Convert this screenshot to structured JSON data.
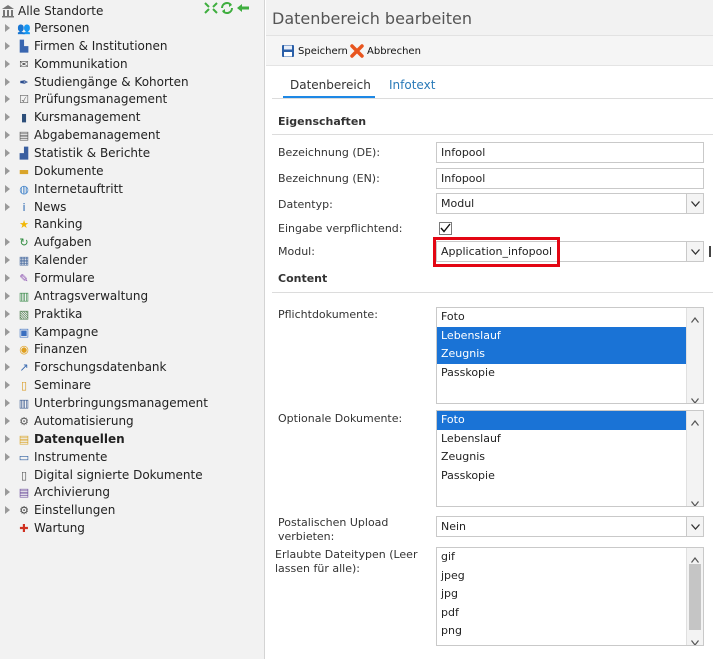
{
  "sidebar": {
    "root": {
      "label": "Alle Standorte",
      "icon": "building-icon"
    },
    "root_actions": [
      {
        "name": "expand-all-icon",
        "color": "#3fae3f"
      },
      {
        "name": "refresh-icon",
        "color": "#3fae3f"
      },
      {
        "name": "back-arrow-icon",
        "color": "#3fae3f"
      }
    ],
    "items": [
      {
        "label": "Personen",
        "icon": "persons-icon",
        "glyph": "👥",
        "color": "#7a55c8",
        "expandable": true
      },
      {
        "label": "Firmen & Institutionen",
        "icon": "factory-icon",
        "glyph": "▙",
        "color": "#3a66b0",
        "expandable": true
      },
      {
        "label": "Kommunikation",
        "icon": "envelope-icon",
        "glyph": "✉",
        "color": "#555555",
        "expandable": true
      },
      {
        "label": "Studiengänge & Kohorten",
        "icon": "feather-icon",
        "glyph": "✒",
        "color": "#2b4d8f",
        "expandable": true
      },
      {
        "label": "Prüfungsmanagement",
        "icon": "checklist-icon",
        "glyph": "☑",
        "color": "#666666",
        "expandable": true
      },
      {
        "label": "Kursmanagement",
        "icon": "book-icon",
        "glyph": "▮",
        "color": "#2d4f7a",
        "expandable": true
      },
      {
        "label": "Abgabemanagement",
        "icon": "submission-icon",
        "glyph": "▤",
        "color": "#555555",
        "expandable": true
      },
      {
        "label": "Statistik & Berichte",
        "icon": "bar-chart-icon",
        "glyph": "▟",
        "color": "#3a5fa0",
        "expandable": true
      },
      {
        "label": "Dokumente",
        "icon": "folder-icon",
        "glyph": "▬",
        "color": "#d9a52a",
        "expandable": true
      },
      {
        "label": "Internetauftritt",
        "icon": "globe-icon",
        "glyph": "◍",
        "color": "#3a7ec8",
        "expandable": true
      },
      {
        "label": "News",
        "icon": "info-icon",
        "glyph": "i",
        "color": "#1f5fae",
        "expandable": true
      },
      {
        "label": "Ranking",
        "icon": "star-icon",
        "glyph": "★",
        "color": "#f2b705",
        "expandable": false
      },
      {
        "label": "Aufgaben",
        "icon": "clock-arrow-icon",
        "glyph": "↻",
        "color": "#2e8b3e",
        "expandable": true
      },
      {
        "label": "Kalender",
        "icon": "calendar-icon",
        "glyph": "▦",
        "color": "#4a6ca0",
        "expandable": true
      },
      {
        "label": "Formulare",
        "icon": "form-icon",
        "glyph": "✎",
        "color": "#8a4fb0",
        "expandable": true
      },
      {
        "label": "Antragsverwaltung",
        "icon": "application-icon",
        "glyph": "▥",
        "color": "#3a8a4a",
        "expandable": true
      },
      {
        "label": "Praktika",
        "icon": "internship-icon",
        "glyph": "▧",
        "color": "#4a7a4a",
        "expandable": true
      },
      {
        "label": "Kampagne",
        "icon": "gift-icon",
        "glyph": "▣",
        "color": "#3a6fc0",
        "expandable": true
      },
      {
        "label": "Finanzen",
        "icon": "coins-icon",
        "glyph": "◉",
        "color": "#e0a020",
        "expandable": true
      },
      {
        "label": "Forschungsdatenbank",
        "icon": "trend-chart-icon",
        "glyph": "↗",
        "color": "#3a6ab0",
        "expandable": true
      },
      {
        "label": "Seminare",
        "icon": "seminar-icon",
        "glyph": "▯",
        "color": "#d99a20",
        "expandable": true
      },
      {
        "label": "Unterbringungsmanagement",
        "icon": "housing-icon",
        "glyph": "▥",
        "color": "#3a5a90",
        "expandable": true
      },
      {
        "label": "Automatisierung",
        "icon": "cog-icon",
        "glyph": "⚙",
        "color": "#555555",
        "expandable": true
      },
      {
        "label": "Datenquellen",
        "icon": "data-sources-icon",
        "glyph": "▤",
        "color": "#d9a52a",
        "expandable": true,
        "active": true
      },
      {
        "label": "Instrumente",
        "icon": "instrument-icon",
        "glyph": "▭",
        "color": "#2e5fa0",
        "expandable": true
      },
      {
        "label": "Digital signierte Dokumente",
        "icon": "signed-document-icon",
        "glyph": "▯",
        "color": "#555555",
        "expandable": false
      },
      {
        "label": "Archivierung",
        "icon": "archive-icon",
        "glyph": "▤",
        "color": "#6a4a9a",
        "expandable": true
      },
      {
        "label": "Einstellungen",
        "icon": "settings-icon",
        "glyph": "⚙",
        "color": "#444444",
        "expandable": true
      },
      {
        "label": "Wartung",
        "icon": "first-aid-icon",
        "glyph": "✚",
        "color": "#d03020",
        "expandable": false
      }
    ]
  },
  "header": {
    "title": "Datenbereich bearbeiten"
  },
  "toolbar": {
    "save_label": "Speichern",
    "cancel_label": "Abbrechen"
  },
  "tabs": [
    {
      "label": "Datenbereich",
      "active": true
    },
    {
      "label": "Infotext",
      "active": false
    }
  ],
  "sections": {
    "eigenschaften": "Eigenschaften",
    "content": "Content"
  },
  "form": {
    "bezeichnung_de": {
      "label": "Bezeichnung (DE):",
      "value": "Infopool"
    },
    "bezeichnung_en": {
      "label": "Bezeichnung (EN):",
      "value": "Infopool"
    },
    "datentyp": {
      "label": "Datentyp:",
      "value": "Modul"
    },
    "eingabe": {
      "label": "Eingabe verpflichtend:",
      "checked": true
    },
    "modul": {
      "label": "Modul:",
      "value": "Application_infopool"
    },
    "pflicht": {
      "label": "Pflichtdokumente:",
      "options": [
        {
          "label": "Foto",
          "selected": false
        },
        {
          "label": "Lebenslauf",
          "selected": true
        },
        {
          "label": "Zeugnis",
          "selected": true
        },
        {
          "label": "Passkopie",
          "selected": false
        }
      ]
    },
    "optional": {
      "label": "Optionale Dokumente:",
      "options": [
        {
          "label": "Foto",
          "selected": true
        },
        {
          "label": "Lebenslauf",
          "selected": false
        },
        {
          "label": "Zeugnis",
          "selected": false
        },
        {
          "label": "Passkopie",
          "selected": false
        }
      ]
    },
    "postal": {
      "label": "Postalischen Upload verbieten:",
      "value": "Nein"
    },
    "dateitypen": {
      "label": "Erlaubte Dateitypen (Leer lassen für alle):",
      "options": [
        {
          "label": "gif",
          "selected": false
        },
        {
          "label": "jpeg",
          "selected": false
        },
        {
          "label": "jpg",
          "selected": false
        },
        {
          "label": "pdf",
          "selected": false
        },
        {
          "label": "png",
          "selected": false
        }
      ]
    }
  },
  "colors": {
    "accent": "#1e88e5",
    "selection": "#1a73d6",
    "highlight_frame": "#e30613",
    "link": "#2a7ab8"
  }
}
